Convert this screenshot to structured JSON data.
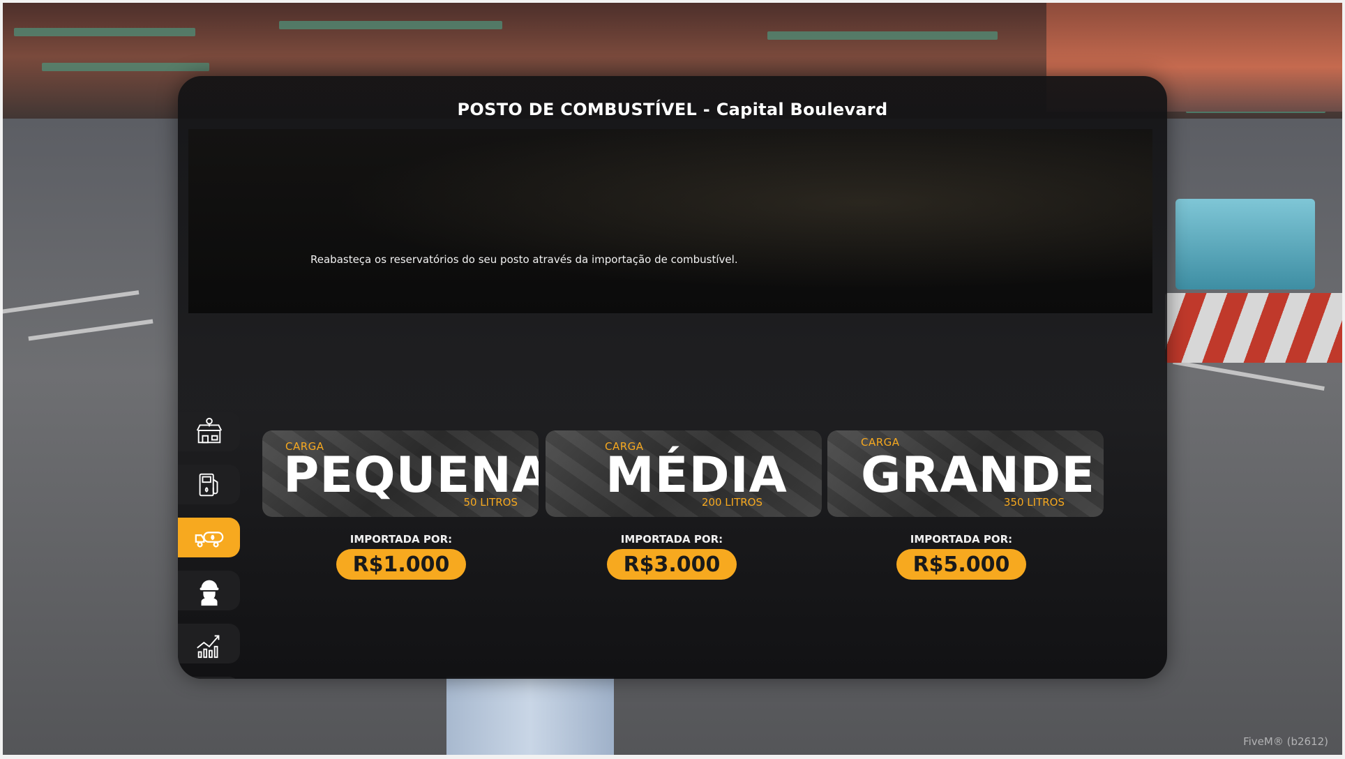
{
  "panel": {
    "title": "POSTO DE COMBUSTÍVEL - Capital Boulevard",
    "banner_text": "Reabasteça os reservatórios do seu posto através da importação de combustível."
  },
  "sidebar": {
    "items": [
      {
        "icon": "store-location-icon",
        "active": false
      },
      {
        "icon": "fuel-pump-icon",
        "active": false
      },
      {
        "icon": "tanker-truck-icon",
        "active": true
      },
      {
        "icon": "worker-helmet-icon",
        "active": false
      },
      {
        "icon": "growth-chart-icon",
        "active": false
      },
      {
        "icon": "wallet-money-icon",
        "active": false
      }
    ]
  },
  "cards": [
    {
      "kicker": "CARGA",
      "name": "PEQUENA",
      "liters": "50 LITROS",
      "price_label": "IMPORTADA POR:",
      "price": "R$1.000"
    },
    {
      "kicker": "CARGA",
      "name": "MÉDIA",
      "liters": "200 LITROS",
      "price_label": "IMPORTADA POR:",
      "price": "R$3.000"
    },
    {
      "kicker": "CARGA",
      "name": "GRANDE",
      "liters": "350 LITROS",
      "price_label": "IMPORTADA POR:",
      "price": "R$5.000"
    }
  ],
  "overlay": {
    "fivem_tag": "FiveM® (b2612)"
  },
  "colors": {
    "accent": "#f7a91f",
    "panel_bg": "#141416",
    "sidebar_btn": "#1f1f21"
  }
}
